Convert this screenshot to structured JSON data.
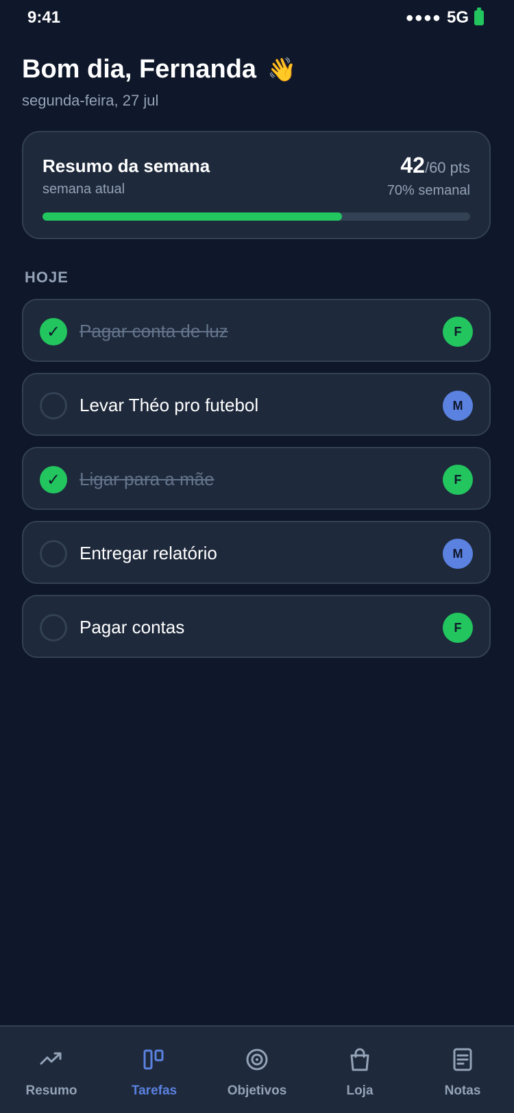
{
  "status_bar": {
    "time": "9:41",
    "signal": "●●●●",
    "network": "5G"
  },
  "header": {
    "greeting": "Bom dia, Fernanda",
    "emoji": "👋",
    "date": "segunda-feira, 27 jul"
  },
  "summary": {
    "title": "Resumo da semana",
    "subtitle": "semana atual",
    "points": "42",
    "points_total": "/60 pts",
    "percent_label": "70% semanal",
    "progress_fraction": 0.7,
    "progress_color": "#22c55e"
  },
  "section": {
    "label": "HOJE"
  },
  "tasks": [
    {
      "label": "Pagar conta de luz",
      "done": true,
      "assignee": "F",
      "assignee_color": "#22c55e"
    },
    {
      "label": "Levar Théo pro futebol",
      "done": false,
      "assignee": "M",
      "assignee_color": "#5b82e0"
    },
    {
      "label": "Ligar para a mãe",
      "done": true,
      "assignee": "F",
      "assignee_color": "#22c55e"
    },
    {
      "label": "Entregar relatório",
      "done": false,
      "assignee": "M",
      "assignee_color": "#5b82e0"
    },
    {
      "label": "Pagar contas",
      "done": false,
      "assignee": "F",
      "assignee_color": "#22c55e"
    }
  ],
  "check_glyph": "✓",
  "tab_bar": {
    "active": "tarefas",
    "tabs": [
      {
        "id": "resumo",
        "label": "Resumo",
        "icon": "trending-up-icon"
      },
      {
        "id": "tarefas",
        "label": "Tarefas",
        "icon": "board-icon"
      },
      {
        "id": "objetivos",
        "label": "Objetivos",
        "icon": "target-icon"
      },
      {
        "id": "loja",
        "label": "Loja",
        "icon": "shopping-bag-icon"
      },
      {
        "id": "notas",
        "label": "Notas",
        "icon": "note-icon"
      }
    ]
  },
  "colors": {
    "background": "#0f172a",
    "card": "#1e293b",
    "accent": "#5b82e0",
    "success": "#22c55e"
  }
}
